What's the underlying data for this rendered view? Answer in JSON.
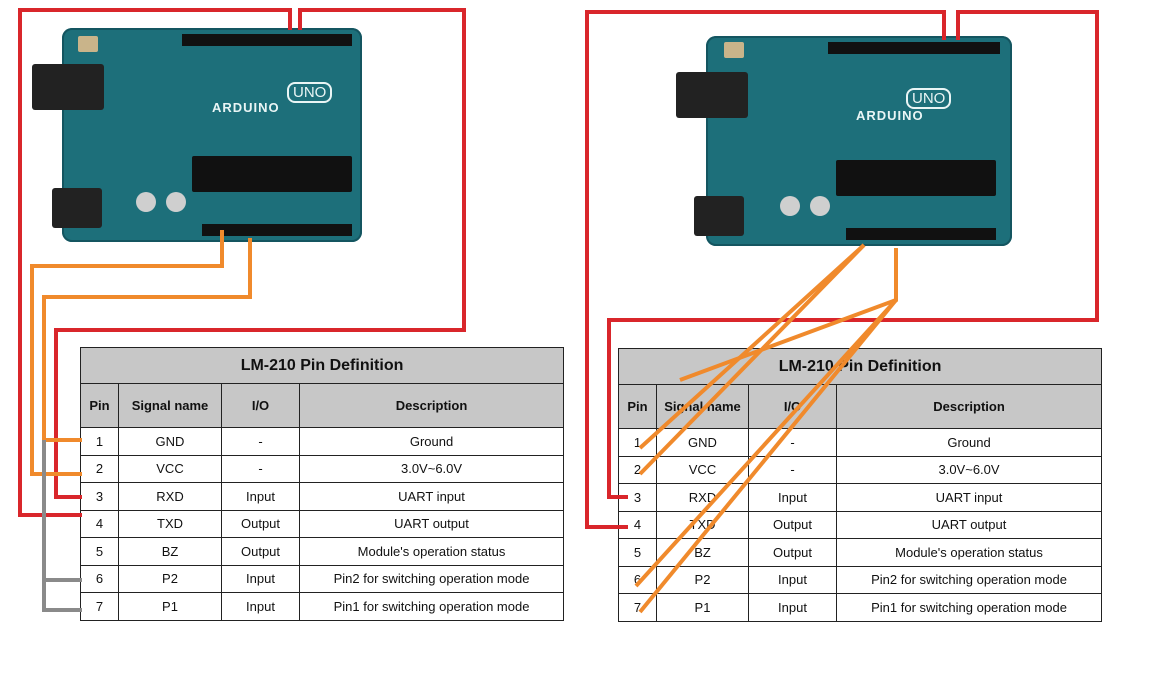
{
  "boards": [
    {
      "brand": "ARDUINO",
      "model": "UNO"
    },
    {
      "brand": "ARDUINO",
      "model": "UNO"
    }
  ],
  "tables": [
    {
      "title": "LM-210 Pin Definition",
      "headers": [
        "Pin",
        "Signal name",
        "I/O",
        "Description"
      ],
      "rows": [
        [
          "1",
          "GND",
          "-",
          "Ground"
        ],
        [
          "2",
          "VCC",
          "-",
          "3.0V~6.0V"
        ],
        [
          "3",
          "RXD",
          "Input",
          "UART input"
        ],
        [
          "4",
          "TXD",
          "Output",
          "UART output"
        ],
        [
          "5",
          "BZ",
          "Output",
          "Module's operation status"
        ],
        [
          "6",
          "P2",
          "Input",
          "Pin2 for switching operation mode"
        ],
        [
          "7",
          "P1",
          "Input",
          "Pin1 for switching operation mode"
        ]
      ]
    },
    {
      "title": "LM-210 Pin Definition",
      "headers": [
        "Pin",
        "Signal name",
        "I/O",
        "Description"
      ],
      "rows": [
        [
          "1",
          "GND",
          "-",
          "Ground"
        ],
        [
          "2",
          "VCC",
          "-",
          "3.0V~6.0V"
        ],
        [
          "3",
          "RXD",
          "Input",
          "UART input"
        ],
        [
          "4",
          "TXD",
          "Output",
          "UART output"
        ],
        [
          "5",
          "BZ",
          "Output",
          "Module's operation status"
        ],
        [
          "6",
          "P2",
          "Input",
          "Pin2 for switching operation mode"
        ],
        [
          "7",
          "P1",
          "Input",
          "Pin1 for switching operation mode"
        ]
      ]
    }
  ],
  "colors": {
    "red_wire": "#d9262b",
    "orange_wire": "#f08a2c",
    "gray_wire": "#8a8a8a",
    "board": "#1d6f7a"
  }
}
